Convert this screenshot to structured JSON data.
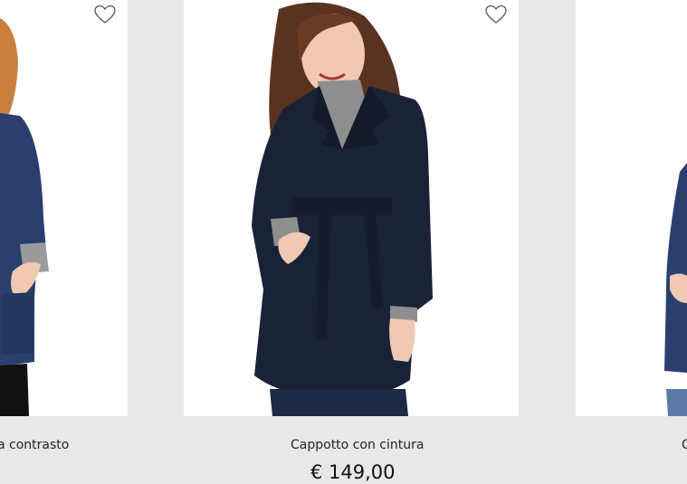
{
  "products": [
    {
      "title": "a contrasto",
      "price": ""
    },
    {
      "title": "Cappotto con cintura",
      "price": "€ 149,00"
    },
    {
      "title": "C",
      "price": ""
    }
  ],
  "colors": {
    "background": "#e8e8e8",
    "card": "#ffffff",
    "coat": "#1a2238",
    "coat_blue": "#2b3f6f",
    "sweater": "#8e8e8e"
  },
  "icons": {
    "wishlist": "heart-outline-icon"
  }
}
